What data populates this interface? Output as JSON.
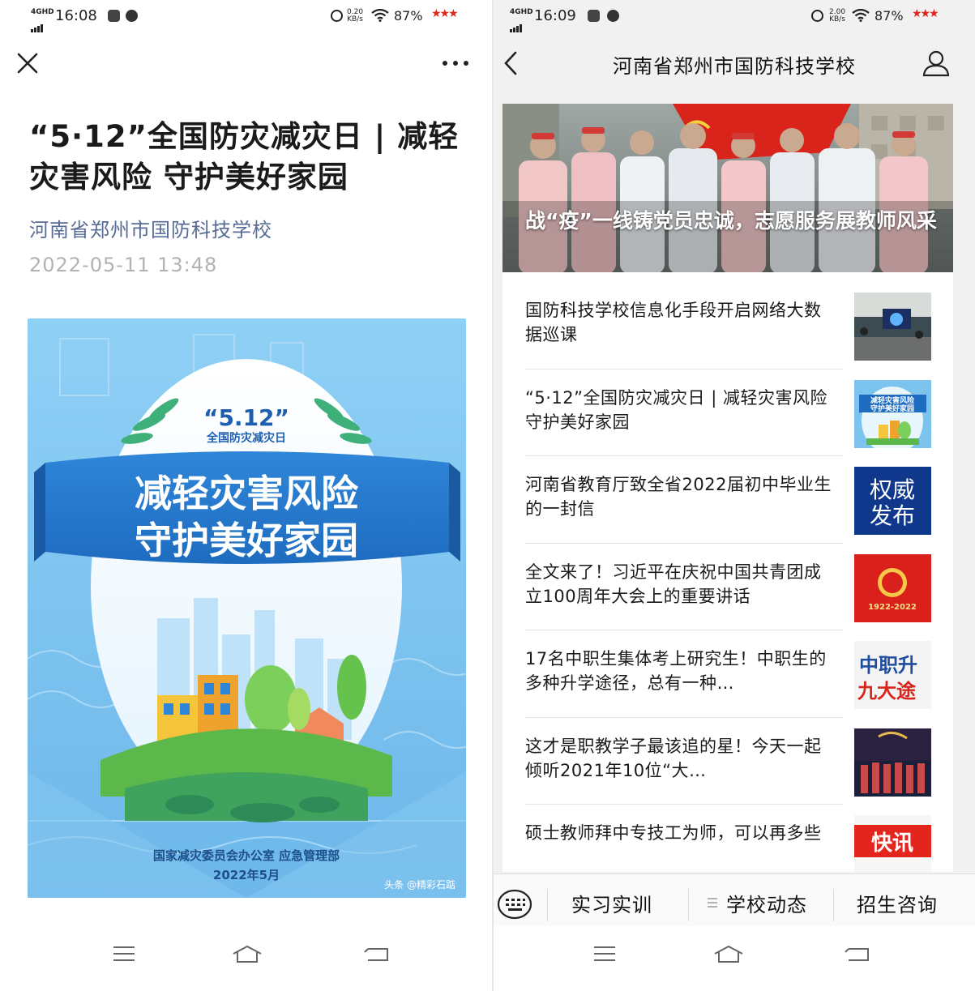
{
  "left": {
    "status": {
      "network": "4GHD",
      "time": "16:08",
      "speed_value": "0.20",
      "speed_unit": "KB/s",
      "battery": "87%"
    },
    "article": {
      "title": "“5·12”全国防灾减灾日 | 减轻灾害风险 守护美好家园",
      "author": "河南省郑州市国防科技学校",
      "date": "2022-05-11 13:48"
    },
    "poster": {
      "badge_line1": "“5.12”",
      "badge_line2": "全国防灾减灾日",
      "headline_line1": "减轻灾害风险",
      "headline_line2": "守护美好家园",
      "footer_line1": "国家减灾委员会办公室  应急管理部",
      "footer_line2": "2022年5月",
      "watermark": "头条 @精彩石踮"
    }
  },
  "right": {
    "status": {
      "network": "4GHD",
      "time": "16:09",
      "speed_value": "2.00",
      "speed_unit": "KB/s",
      "battery": "87%"
    },
    "header": {
      "title": "河南省郑州市国防科技学校"
    },
    "banner": {
      "caption": "战“疫”一线铸党员忠诚，志愿服务展教师风采"
    },
    "news": [
      {
        "title": "国防科技学校信息化手段开启网络大数据巡课",
        "thumb": "classroom"
      },
      {
        "title": "“5·12”全国防灾减灾日 | 减轻灾害风险 守护美好家园",
        "thumb": "poster",
        "thumb_line1": "减轻灾害风险",
        "thumb_line2": "守护美好家园"
      },
      {
        "title": "河南省教育厅致全省2022届初中毕业生的一封信",
        "thumb": "authority",
        "thumb_line1": "权威",
        "thumb_line2": "发布"
      },
      {
        "title": "全文来了！习近平在庆祝中国共青团成立100周年大会上的重要讲话",
        "thumb": "league",
        "thumb_line1": "1922-2022"
      },
      {
        "title": "17名中职生集体考上研究生！中职生的多种升学途径，总有一种…",
        "thumb": "paths",
        "thumb_line1": "中职升",
        "thumb_line2": "九大途"
      },
      {
        "title": "这才是职教学子最该追的星！今天一起倾听2021年10位“大…",
        "thumb": "stage"
      },
      {
        "title": "硕士教师拜中专技工为师，可以再多些",
        "thumb": "flash",
        "thumb_line1": "快讯"
      }
    ],
    "menu": {
      "tab1": "实习实训",
      "tab2": "学校动态",
      "tab3": "招生咨询"
    }
  },
  "colors": {
    "link_blue": "#576b95",
    "poster_blue": "#7cc3ee",
    "banner_red": "#d9241c"
  }
}
